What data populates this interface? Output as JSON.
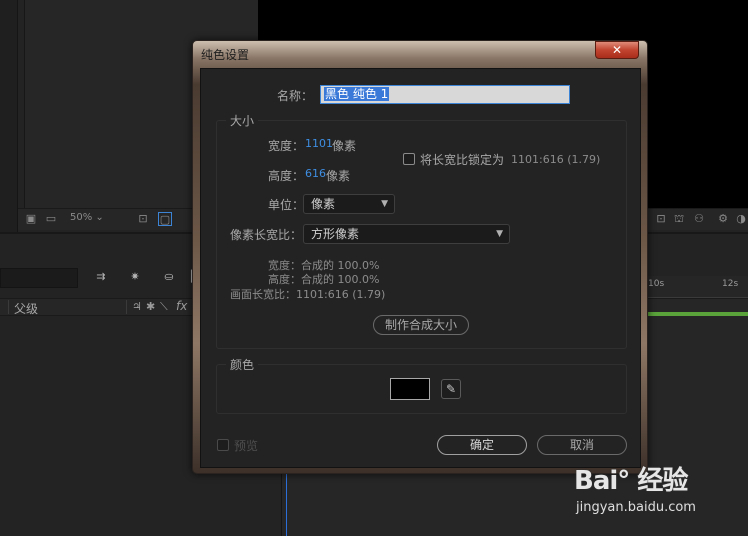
{
  "background": {
    "zoom_value": "50%",
    "timeline_parent_label": "父级",
    "ruler_labels": [
      "10s",
      "12s"
    ],
    "switch_icons": [
      "♃",
      "✱",
      "⟍",
      "fx"
    ]
  },
  "dialog": {
    "title": "纯色设置",
    "close_glyph": "✕",
    "name_label": "名称：",
    "name_value": "黑色 纯色 1",
    "size_section": {
      "legend": "大小",
      "width_label": "宽度：",
      "width_value": "1101",
      "width_unit": "像素",
      "height_label": "高度：",
      "height_value": "616",
      "height_unit": "像素",
      "lock_label": "将长宽比锁定为",
      "lock_ratio": "1101:616 (1.79)",
      "units_label": "单位：",
      "units_value": "像素",
      "par_label": "像素长宽比：",
      "par_value": "方形像素",
      "comp_width_line": "宽度：合成的 100.0%",
      "comp_height_line": "高度：合成的 100.0%",
      "frame_ratio_line": "画面长宽比：1101:616 (1.79)",
      "make_comp_size_button": "制作合成大小"
    },
    "color_section": {
      "legend": "颜色",
      "swatch_color": "#000000"
    },
    "preview_label": "预览",
    "ok_button": "确定",
    "cancel_button": "取消"
  },
  "watermark": {
    "logo_text": "Bai° 经验",
    "url": "jingyan.baidu.com"
  }
}
